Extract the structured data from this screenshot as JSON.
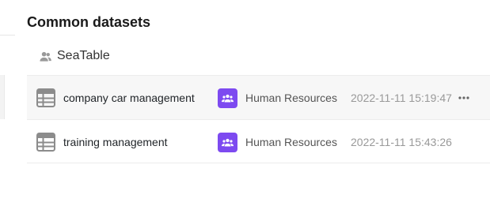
{
  "section": {
    "title": "Common datasets"
  },
  "group": {
    "name": "SeaTable",
    "icon": "group-icon"
  },
  "colors": {
    "badge": "#7d4af0",
    "hover_bg": "#f7f7f7",
    "divider": "#ececec"
  },
  "datasets": [
    {
      "name": "company car management",
      "group": "Human Resources",
      "updated": "2022-11-11 15:19:47",
      "icon": "table-icon",
      "group_icon": "group-icon",
      "hovered": true,
      "more_icon": "more-icon"
    },
    {
      "name": "training management",
      "group": "Human Resources",
      "updated": "2022-11-11 15:43:26",
      "icon": "table-icon",
      "group_icon": "group-icon",
      "hovered": false
    }
  ]
}
